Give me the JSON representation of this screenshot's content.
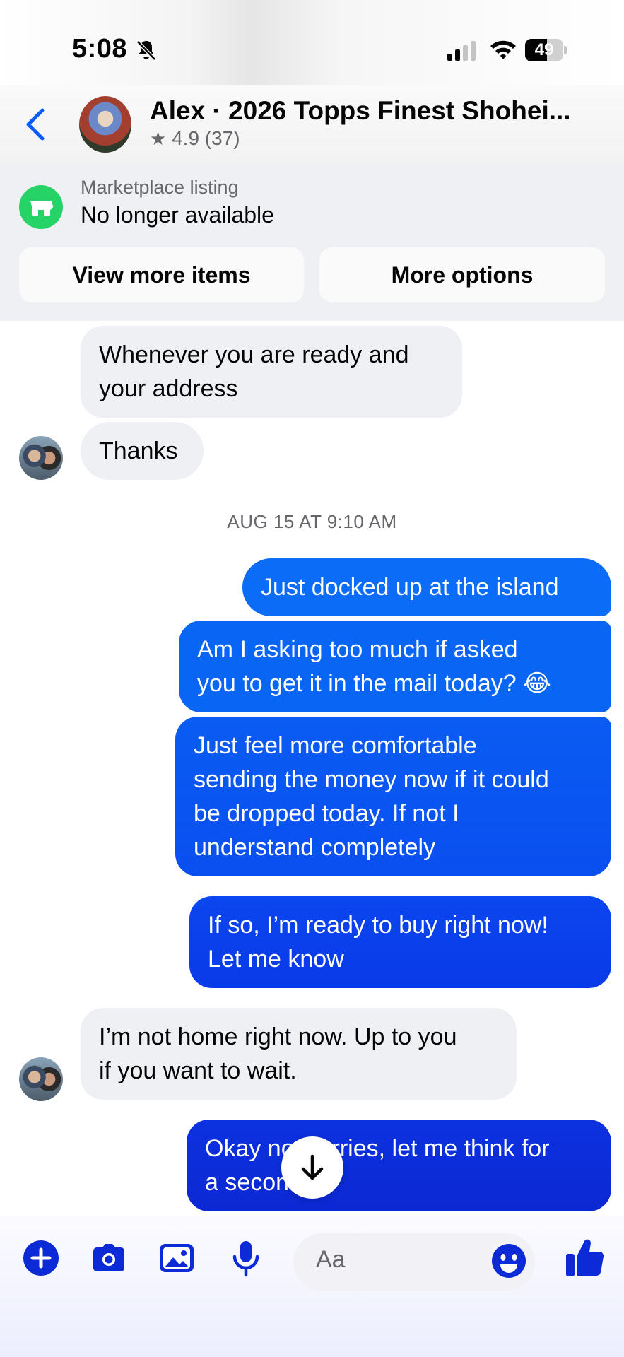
{
  "status_bar": {
    "time": "5:08",
    "battery": "49"
  },
  "header": {
    "title": "Alex · 2026 Topps Finest Shohei...",
    "rating": "4.9 (37)"
  },
  "marketplace": {
    "label": "Marketplace listing",
    "status": "No longer available",
    "view_more": "View more items",
    "more_options": "More options"
  },
  "messages": [
    {
      "from": "them",
      "lines": [
        "Whenever you are ready and",
        "your address"
      ]
    },
    {
      "from": "them",
      "lines": [
        "Thanks"
      ]
    },
    {
      "from": "me",
      "lines": [
        "Just docked up at the island"
      ]
    },
    {
      "from": "me",
      "lines": [
        "Am I asking too much if asked",
        "you to get it in the mail today? 😂"
      ]
    },
    {
      "from": "me",
      "lines": [
        "Just feel more comfortable",
        "sending the money now if it could",
        "be dropped today. If not I",
        "understand completely"
      ]
    },
    {
      "from": "me",
      "lines": [
        "If so, I’m ready to buy right now!",
        "Let me know"
      ]
    },
    {
      "from": "them",
      "lines": [
        "I’m not home right now. Up to you",
        "if you want to wait."
      ]
    },
    {
      "from": "me",
      "lines": [
        "Okay no worries, let me think for",
        "a second"
      ]
    }
  ],
  "timestamp": "AUG 15 AT 9:10 AM",
  "composer": {
    "placeholder": "Aa"
  },
  "icons": [
    "back-icon",
    "plus-icon",
    "camera-icon",
    "photo-icon",
    "microphone-icon",
    "emoji-icon",
    "thumbs-up-icon",
    "arrow-down-icon",
    "shop-icon",
    "star-icon",
    "bell-slash-icon",
    "signal-icon",
    "wifi-icon",
    "battery-icon"
  ],
  "colors": {
    "accent": "#0a5cff",
    "bubble_out_top": "#0b6cf7",
    "bubble_out_bottom": "#0c2bd6",
    "bubble_in": "#eff0f4",
    "marketplace_green": "#25d366"
  }
}
